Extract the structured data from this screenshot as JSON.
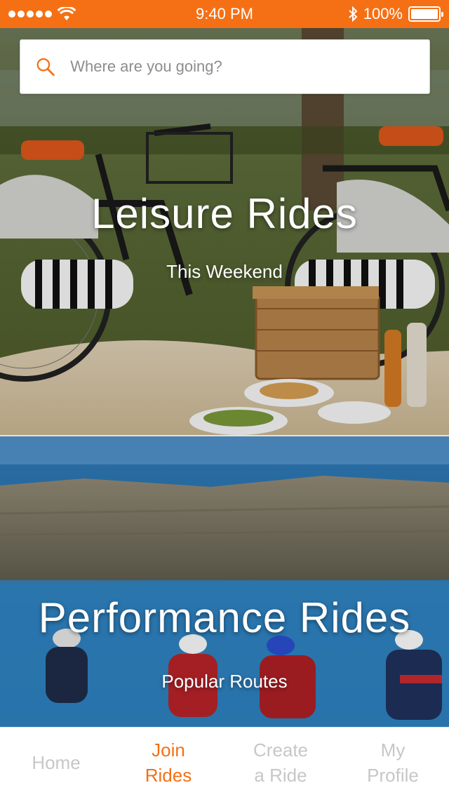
{
  "colors": {
    "accent": "#f57014",
    "tab_inactive": "#c7c7c7",
    "placeholder": "#8d8d8d"
  },
  "status_bar": {
    "time": "9:40 PM",
    "battery": "100%",
    "battery_level": 1.0,
    "icons": [
      "signal-dots-icon",
      "wifi-icon",
      "bluetooth-icon",
      "battery-icon"
    ]
  },
  "search": {
    "placeholder": "Where are you going?",
    "value": "",
    "icon": "search-icon"
  },
  "cards": [
    {
      "title": "Leisure Rides",
      "subtitle": "This Weekend"
    },
    {
      "title": "Performance Rides",
      "subtitle": "Popular Routes"
    }
  ],
  "tabs": [
    {
      "line1": "Home",
      "line2": "",
      "active": false
    },
    {
      "line1": "Join",
      "line2": "Rides",
      "active": true
    },
    {
      "line1": "Create",
      "line2": "a Ride",
      "active": false
    },
    {
      "line1": "My",
      "line2": "Profile",
      "active": false
    }
  ]
}
